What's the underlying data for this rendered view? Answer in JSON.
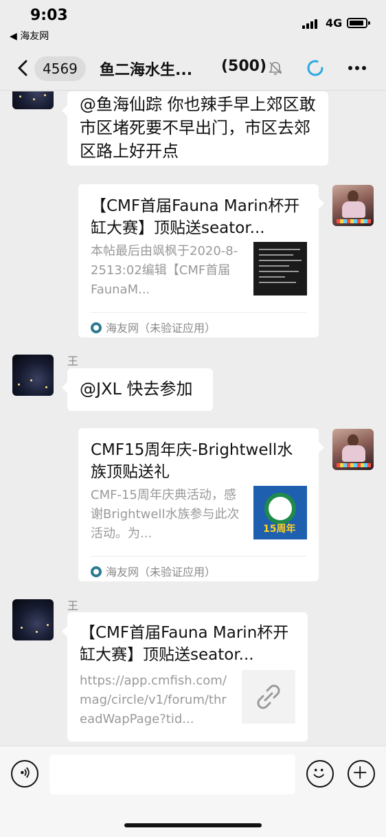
{
  "status_bar": {
    "time": "9:03",
    "back_app": "◀ 海友网",
    "network": "4G"
  },
  "nav": {
    "unread_count": "4569",
    "title": "鱼二海水生...",
    "member_count": "(500)",
    "icons": [
      "back-icon",
      "mute-bell-icon",
      "loading-icon",
      "more-icon"
    ]
  },
  "messages": [
    {
      "type": "text",
      "side": "left",
      "text": "@鱼海仙踪 你也辣手早上郊区敢市区堵死要不早出门，市区去郊区路上好开点"
    },
    {
      "type": "card",
      "side": "right",
      "title": "【CMF首届Fauna Marin杯开缸大赛】顶贴送seator...",
      "desc": "本帖最后由飒枫于2020-8-2513:02编辑【CMF首届FaunaM...",
      "source": "海友网（未验证应用）"
    },
    {
      "type": "text",
      "side": "left",
      "sender": "王",
      "text": "@JXL 快去参加"
    },
    {
      "type": "card",
      "side": "right",
      "title": "CMF15周年庆-Brightwell水族顶贴送礼",
      "desc": "CMF-15周年庆典活动，感谢Brightwell水族参与此次活动。为...",
      "thumb_text": "15周年",
      "source": "海友网（未验证应用）"
    },
    {
      "type": "link",
      "side": "left",
      "sender": "王",
      "title": "【CMF首届Fauna Marin杯开缸大赛】顶贴送seator...",
      "desc": "https://app.cmfish.com/mag/circle/v1/forum/threadWapPage?tid..."
    }
  ],
  "input": {
    "placeholder": ""
  },
  "colors": {
    "background": "#ededed",
    "bubble": "#ffffff",
    "accent": "#2aa7e0"
  }
}
